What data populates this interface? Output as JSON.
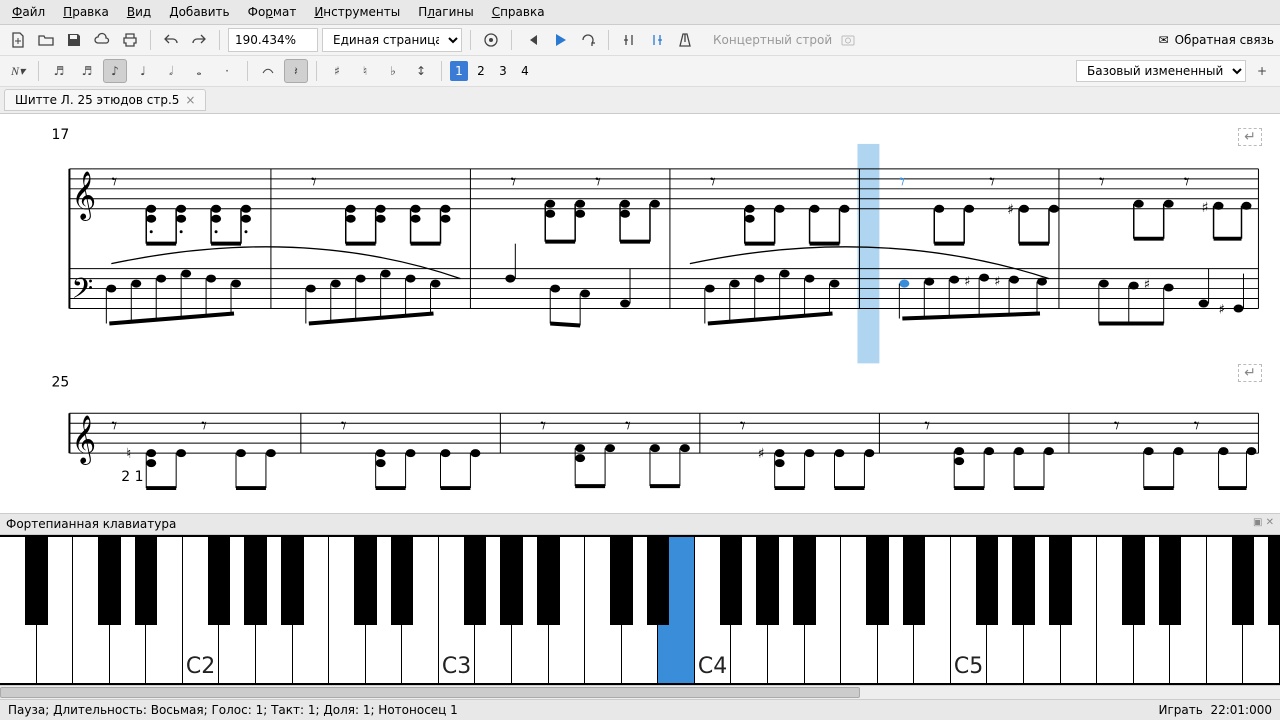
{
  "menu": [
    "Файл",
    "Правка",
    "Вид",
    "Добавить",
    "Формат",
    "Инструменты",
    "Плагины",
    "Справка"
  ],
  "toolbar": {
    "zoom": "190.434%",
    "page_mode": "Единая страница",
    "concert_pitch": "Концертный строй",
    "feedback": "Обратная связь",
    "workspace": "Базовый измененный"
  },
  "note_input": {
    "voices": [
      "1",
      "2",
      "3",
      "4"
    ],
    "active_voice": "1"
  },
  "tab": {
    "title": "Шитте Л. 25 этюдов стр.5"
  },
  "score": {
    "system1_measure": "17",
    "system2_measure": "25",
    "fingering": "2 1"
  },
  "piano": {
    "header": "Фортепианная клавиатура",
    "labels": [
      "C2",
      "C3",
      "C4",
      "C5"
    ],
    "highlighted_key": "B3"
  },
  "status": {
    "left": "Пауза; Длительность: Восьмая; Голос: 1;  Такт: 1; Доля: 1; Нотоносец 1",
    "right_action": "Играть",
    "right_time": "22:01:000"
  }
}
